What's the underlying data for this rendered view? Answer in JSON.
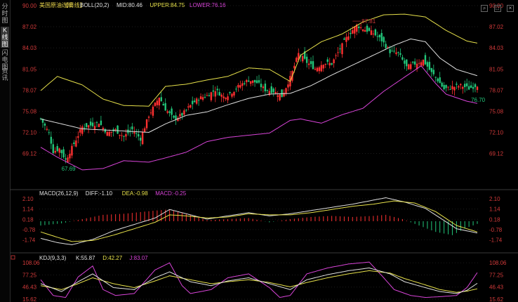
{
  "sidebar": {
    "tabs": [
      {
        "label": "分时图"
      },
      {
        "label": "K线图"
      },
      {
        "label": "闪电图"
      },
      {
        "label": "资讯"
      }
    ]
  },
  "toolbar": {
    "icons": [
      "search-icon",
      "maximize-icon",
      "close-icon"
    ]
  },
  "chart_data": [
    {
      "type": "candlestick",
      "title": "美国原油连续",
      "period_label": "【日线】",
      "indicator": "BOLL(20,2)",
      "legend": [
        {
          "text": "MID:80.46",
          "color": "#e0e0e0"
        },
        {
          "text": "UPPER:84.75",
          "color": "#e6e04a"
        },
        {
          "text": "LOWER:76.16",
          "color": "#d844d8"
        }
      ],
      "y_ticks": [
        "90.00",
        "87.02",
        "84.03",
        "81.05",
        "78.07",
        "75.08",
        "72.10",
        "69.12"
      ],
      "ylim": [
        66.2,
        90.0
      ],
      "annotations": [
        {
          "text": "87.81",
          "value": 87.81
        },
        {
          "text": "67.69",
          "value": 67.69
        },
        {
          "text": "76.70",
          "value": 76.7
        }
      ],
      "colors": {
        "up": "#ff3030",
        "down": "#22c67a",
        "mid": "#e0e0e0",
        "upper": "#e6e04a",
        "lower": "#d844d8"
      },
      "anchors": [
        [
          0,
          74.0
        ],
        [
          4,
          72.0
        ],
        [
          6,
          69.4
        ],
        [
          9,
          69.8
        ],
        [
          12,
          68.2
        ],
        [
          16,
          70.5
        ],
        [
          20,
          72.9
        ],
        [
          24,
          73.1
        ],
        [
          28,
          73.5
        ],
        [
          32,
          72.0
        ],
        [
          36,
          72.4
        ],
        [
          40,
          71.5
        ],
        [
          44,
          72.5
        ],
        [
          48,
          71.2
        ],
        [
          52,
          74.5
        ],
        [
          57,
          77.1
        ],
        [
          60,
          75.4
        ],
        [
          64,
          74.0
        ],
        [
          68,
          74.6
        ],
        [
          72,
          75.9
        ],
        [
          76,
          76.9
        ],
        [
          80,
          77.3
        ],
        [
          84,
          78.1
        ],
        [
          88,
          77.1
        ],
        [
          92,
          77.8
        ],
        [
          96,
          78.8
        ],
        [
          100,
          79.5
        ],
        [
          104,
          79.1
        ],
        [
          108,
          78.1
        ],
        [
          112,
          77.9
        ],
        [
          116,
          77.2
        ],
        [
          120,
          79.8
        ],
        [
          124,
          83.2
        ],
        [
          128,
          82.0
        ],
        [
          132,
          81.1
        ],
        [
          136,
          81.9
        ],
        [
          140,
          81.8
        ],
        [
          144,
          83.9
        ],
        [
          148,
          85.9
        ],
        [
          152,
          87.2
        ],
        [
          156,
          86.6
        ],
        [
          160,
          86.1
        ],
        [
          164,
          85.1
        ],
        [
          168,
          83.5
        ],
        [
          172,
          83.3
        ],
        [
          176,
          81.3
        ],
        [
          180,
          81.8
        ],
        [
          184,
          82.3
        ],
        [
          188,
          80.5
        ],
        [
          190,
          79.9
        ],
        [
          194,
          78.2
        ],
        [
          198,
          78.5
        ],
        [
          202,
          78.7
        ],
        [
          206,
          78.3
        ],
        [
          210,
          78.8
        ]
      ],
      "mid_anchors": [
        [
          0,
          74.0
        ],
        [
          20,
          72.6
        ],
        [
          40,
          72.3
        ],
        [
          52,
          72.1
        ],
        [
          60,
          73.3
        ],
        [
          70,
          74.5
        ],
        [
          80,
          75.0
        ],
        [
          90,
          76.0
        ],
        [
          100,
          76.9
        ],
        [
          110,
          77.5
        ],
        [
          120,
          77.6
        ],
        [
          130,
          78.7
        ],
        [
          140,
          80.2
        ],
        [
          150,
          81.6
        ],
        [
          160,
          83.0
        ],
        [
          170,
          84.4
        ],
        [
          178,
          85.3
        ],
        [
          185,
          84.9
        ],
        [
          192,
          82.6
        ],
        [
          200,
          81.0
        ],
        [
          210,
          80.1
        ]
      ],
      "upper_anchors": [
        [
          0,
          78.0
        ],
        [
          8,
          80.0
        ],
        [
          20,
          78.8
        ],
        [
          30,
          76.8
        ],
        [
          40,
          75.9
        ],
        [
          52,
          75.8
        ],
        [
          60,
          78.6
        ],
        [
          70,
          78.9
        ],
        [
          80,
          79.5
        ],
        [
          90,
          80.0
        ],
        [
          100,
          81.2
        ],
        [
          110,
          81.0
        ],
        [
          120,
          79.3
        ],
        [
          125,
          83.0
        ],
        [
          135,
          84.9
        ],
        [
          145,
          86.0
        ],
        [
          155,
          87.7
        ],
        [
          165,
          88.7
        ],
        [
          175,
          88.8
        ],
        [
          185,
          88.4
        ],
        [
          195,
          86.5
        ],
        [
          205,
          85.0
        ],
        [
          210,
          84.7
        ]
      ],
      "lower_anchors": [
        [
          0,
          70.0
        ],
        [
          8,
          68.6
        ],
        [
          20,
          66.8
        ],
        [
          30,
          67.0
        ],
        [
          40,
          68.1
        ],
        [
          52,
          67.9
        ],
        [
          60,
          68.5
        ],
        [
          70,
          69.3
        ],
        [
          80,
          70.8
        ],
        [
          90,
          71.4
        ],
        [
          100,
          71.7
        ],
        [
          110,
          72.0
        ],
        [
          120,
          73.8
        ],
        [
          125,
          74.0
        ],
        [
          135,
          73.4
        ],
        [
          145,
          74.6
        ],
        [
          155,
          75.5
        ],
        [
          165,
          77.9
        ],
        [
          175,
          79.9
        ],
        [
          183,
          81.5
        ],
        [
          190,
          79.0
        ],
        [
          195,
          77.5
        ],
        [
          205,
          76.5
        ],
        [
          210,
          76.2
        ]
      ]
    },
    {
      "type": "bar+line",
      "indicator": "MACD(26,12,9)",
      "legend": [
        {
          "text": "DIFF:-1.10",
          "color": "#e0e0e0"
        },
        {
          "text": "DEA:-0.98",
          "color": "#e6e04a"
        },
        {
          "text": "MACD:-0.25",
          "color": "#d844d8"
        }
      ],
      "y_ticks": [
        "2.10",
        "1.14",
        "0.18",
        "-0.78",
        "-1.74"
      ],
      "ylim": [
        -2.3,
        2.3
      ],
      "colors": {
        "diff": "#e0e0e0",
        "dea": "#e6e04a",
        "up": "#ff3030",
        "down": "#22c67a"
      },
      "diff_anchors": [
        [
          0,
          -1.6
        ],
        [
          8,
          -2.0
        ],
        [
          15,
          -2.2
        ],
        [
          25,
          -1.7
        ],
        [
          35,
          -0.9
        ],
        [
          45,
          -0.3
        ],
        [
          55,
          0.3
        ],
        [
          62,
          1.1
        ],
        [
          70,
          0.7
        ],
        [
          80,
          0.2
        ],
        [
          90,
          0.5
        ],
        [
          100,
          0.8
        ],
        [
          110,
          0.5
        ],
        [
          120,
          0.7
        ],
        [
          130,
          1.0
        ],
        [
          140,
          1.3
        ],
        [
          150,
          1.6
        ],
        [
          158,
          1.9
        ],
        [
          166,
          2.2
        ],
        [
          175,
          1.8
        ],
        [
          185,
          1.2
        ],
        [
          193,
          0.2
        ],
        [
          200,
          -0.7
        ],
        [
          210,
          -1.1
        ]
      ],
      "dea_anchors": [
        [
          0,
          -1.0
        ],
        [
          8,
          -1.5
        ],
        [
          15,
          -1.9
        ],
        [
          25,
          -1.8
        ],
        [
          35,
          -1.3
        ],
        [
          45,
          -0.7
        ],
        [
          55,
          -0.1
        ],
        [
          62,
          0.6
        ],
        [
          70,
          0.5
        ],
        [
          80,
          0.3
        ],
        [
          90,
          0.4
        ],
        [
          100,
          0.7
        ],
        [
          110,
          0.6
        ],
        [
          120,
          0.6
        ],
        [
          130,
          0.8
        ],
        [
          140,
          1.1
        ],
        [
          150,
          1.4
        ],
        [
          160,
          1.6
        ],
        [
          170,
          1.9
        ],
        [
          180,
          1.7
        ],
        [
          190,
          0.9
        ],
        [
          200,
          -0.4
        ],
        [
          210,
          -1.0
        ]
      ],
      "hist_anchors": [
        [
          0,
          -0.4
        ],
        [
          10,
          -0.2
        ],
        [
          20,
          0.2
        ],
        [
          30,
          0.6
        ],
        [
          40,
          0.7
        ],
        [
          50,
          0.9
        ],
        [
          55,
          1.0
        ],
        [
          62,
          1.1
        ],
        [
          70,
          0.7
        ],
        [
          80,
          0.1
        ],
        [
          90,
          0.2
        ],
        [
          100,
          0.3
        ],
        [
          110,
          -0.1
        ],
        [
          120,
          0.2
        ],
        [
          130,
          0.4
        ],
        [
          140,
          0.5
        ],
        [
          150,
          0.4
        ],
        [
          160,
          0.5
        ],
        [
          166,
          0.6
        ],
        [
          174,
          0.2
        ],
        [
          182,
          -0.4
        ],
        [
          190,
          -1.0
        ],
        [
          198,
          -1.3
        ],
        [
          205,
          -0.6
        ],
        [
          210,
          -0.25
        ]
      ]
    },
    {
      "type": "line",
      "indicator": "KDJ(9,3,3)",
      "legend": [
        {
          "text": "K:55.87",
          "color": "#e0e0e0"
        },
        {
          "text": "D:42.27",
          "color": "#e6e04a"
        },
        {
          "text": "J:83.07",
          "color": "#d844d8"
        }
      ],
      "y_ticks": [
        "108.06",
        "77.25",
        "46.43",
        "15.62"
      ],
      "ylim": [
        12,
        112
      ],
      "colors": {
        "k": "#e0e0e0",
        "d": "#e6e04a",
        "j": "#d844d8"
      },
      "k_anchors": [
        [
          0,
          55
        ],
        [
          10,
          35
        ],
        [
          18,
          60
        ],
        [
          25,
          80
        ],
        [
          35,
          45
        ],
        [
          45,
          40
        ],
        [
          55,
          70
        ],
        [
          62,
          85
        ],
        [
          72,
          60
        ],
        [
          82,
          50
        ],
        [
          90,
          62
        ],
        [
          100,
          70
        ],
        [
          110,
          55
        ],
        [
          120,
          40
        ],
        [
          128,
          65
        ],
        [
          138,
          78
        ],
        [
          148,
          88
        ],
        [
          158,
          95
        ],
        [
          168,
          80
        ],
        [
          175,
          60
        ],
        [
          185,
          45
        ],
        [
          192,
          35
        ],
        [
          200,
          30
        ],
        [
          205,
          38
        ],
        [
          210,
          56
        ]
      ],
      "d_anchors": [
        [
          0,
          50
        ],
        [
          10,
          40
        ],
        [
          18,
          55
        ],
        [
          25,
          70
        ],
        [
          35,
          55
        ],
        [
          45,
          45
        ],
        [
          55,
          62
        ],
        [
          62,
          75
        ],
        [
          72,
          65
        ],
        [
          82,
          55
        ],
        [
          90,
          60
        ],
        [
          100,
          65
        ],
        [
          110,
          58
        ],
        [
          120,
          47
        ],
        [
          128,
          58
        ],
        [
          138,
          70
        ],
        [
          148,
          80
        ],
        [
          158,
          88
        ],
        [
          168,
          82
        ],
        [
          175,
          68
        ],
        [
          185,
          52
        ],
        [
          192,
          40
        ],
        [
          200,
          33
        ],
        [
          205,
          36
        ],
        [
          210,
          42
        ]
      ],
      "j_anchors": [
        [
          0,
          65
        ],
        [
          6,
          25
        ],
        [
          12,
          20
        ],
        [
          18,
          72
        ],
        [
          25,
          100
        ],
        [
          30,
          40
        ],
        [
          36,
          25
        ],
        [
          45,
          30
        ],
        [
          55,
          90
        ],
        [
          62,
          108
        ],
        [
          68,
          50
        ],
        [
          72,
          30
        ],
        [
          82,
          40
        ],
        [
          90,
          70
        ],
        [
          100,
          80
        ],
        [
          110,
          45
        ],
        [
          115,
          20
        ],
        [
          120,
          25
        ],
        [
          128,
          80
        ],
        [
          138,
          95
        ],
        [
          148,
          105
        ],
        [
          158,
          110
        ],
        [
          165,
          70
        ],
        [
          170,
          40
        ],
        [
          178,
          25
        ],
        [
          185,
          20
        ],
        [
          192,
          22
        ],
        [
          200,
          25
        ],
        [
          205,
          45
        ],
        [
          210,
          83
        ]
      ]
    }
  ]
}
